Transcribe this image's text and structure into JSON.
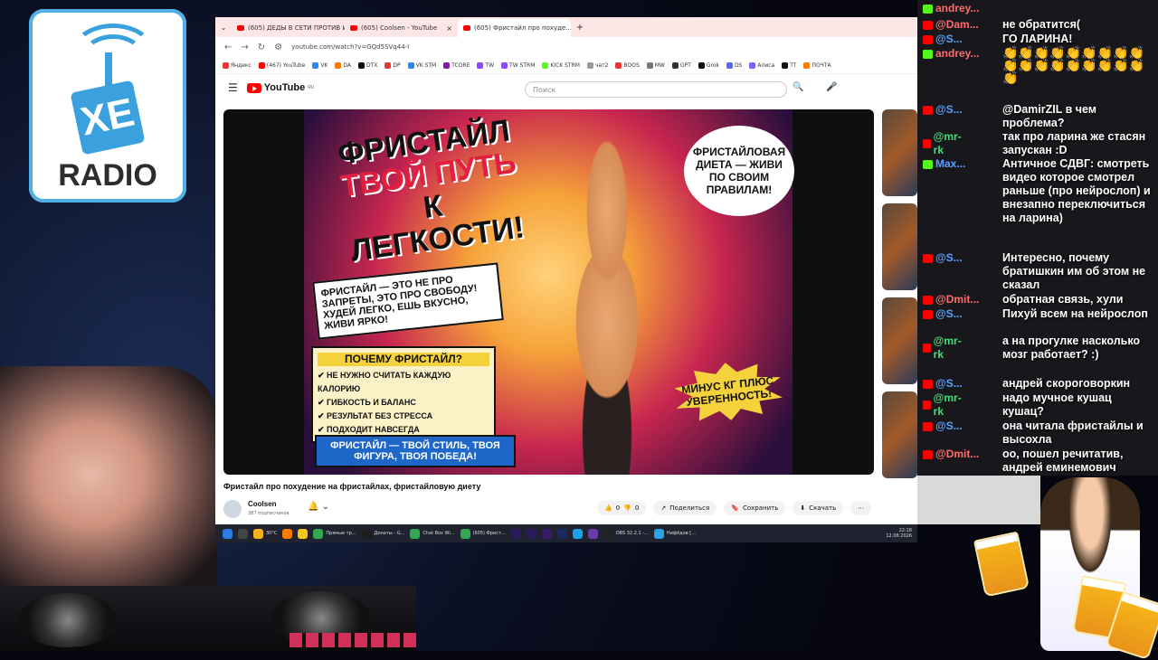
{
  "logo": {
    "text": "XE",
    "radio": "RADIO"
  },
  "browser": {
    "tabs": [
      {
        "title": "(605) ДЕДЫ В СЕТИ ПРОТИВ И...",
        "active": false
      },
      {
        "title": "(605) Coolsen - YouTube",
        "active": false
      },
      {
        "title": "(605) Фристайл про похуде...",
        "active": true
      }
    ],
    "new_tab": "+",
    "url": "youtube.com/watch?v=GQd5SVq44-I",
    "bookmarks": [
      {
        "label": "Яндекс",
        "color": "#e53935"
      },
      {
        "label": "(467) YouTube",
        "color": "#ff0000"
      },
      {
        "label": "VK",
        "color": "#2787f5"
      },
      {
        "label": "DA",
        "color": "#f57c00"
      },
      {
        "label": "DTX",
        "color": "#111"
      },
      {
        "label": "DP",
        "color": "#e53935"
      },
      {
        "label": "VK STM",
        "color": "#2787f5"
      },
      {
        "label": "TCORE",
        "color": "#7b1fa2"
      },
      {
        "label": "TW",
        "color": "#9146ff"
      },
      {
        "label": "TW STRM",
        "color": "#9146ff"
      },
      {
        "label": "KICK STRM",
        "color": "#53fc18"
      },
      {
        "label": "чат2",
        "color": "#999"
      },
      {
        "label": "BOOS",
        "color": "#e53935"
      },
      {
        "label": "MW",
        "color": "#777"
      },
      {
        "label": "GPT",
        "color": "#333"
      },
      {
        "label": "Grok",
        "color": "#111"
      },
      {
        "label": "DS",
        "color": "#5865f2"
      },
      {
        "label": "Алиса",
        "color": "#7b61ff"
      },
      {
        "label": "TT",
        "color": "#111"
      },
      {
        "label": "ПОЧТА",
        "color": "#f57c00"
      }
    ]
  },
  "youtube": {
    "logo": "YouTube",
    "region": "RU",
    "search_placeholder": "Поиск",
    "thumbnail": {
      "headline_1": "ФРИСТАЙЛ",
      "headline_2": "ТВОЙ ПУТЬ",
      "headline_3": "К ЛЕГКОСТИ!",
      "bubble_text": "ФРИСТАЙЛ — ЭТО НЕ ПРО ЗАПРЕТЫ, ЭТО ПРО СВОБОДУ! ХУДЕЙ ЛЕГКО, ЕШЬ ВКУСНО, ЖИВИ ЯРКО!",
      "why_title": "ПОЧЕМУ ФРИСТАЙЛ?",
      "why_items": [
        "НЕ НУЖНО СЧИТАТЬ КАЖДУЮ КАЛОРИЮ",
        "ГИБКОСТЬ И БАЛАНС",
        "РЕЗУЛЬТАТ БЕЗ СТРЕССА",
        "ПОДХОДИТ НАВСЕГДА"
      ],
      "footer_text": "ФРИСТАЙЛ — ТВОЙ СТИЛЬ, ТВОЯ ФИГУРА, ТВОЯ ПОБЕДА!",
      "diet_text": "ФРИСТАЙЛОВАЯ ДИЕТА — ЖИВИ ПО СВОИМ ПРАВИЛАМ!",
      "minus_text": "МИНУС КГ ПЛЮС УВЕРЕННОСТЬ!"
    },
    "video_title": "Фристайл про похудение на фристайлах, фристайловую диету",
    "channel": "Coolsen",
    "subscribers": "387 подписчиков",
    "likes": "0",
    "dislikes": "0",
    "share": "Поделиться",
    "save": "Сохранить",
    "download": "Скачать"
  },
  "taskbar": {
    "items": [
      {
        "label": "",
        "color": "#2a7de1"
      },
      {
        "label": "",
        "color": "#444"
      },
      {
        "label": "30°C",
        "color": "#f5b21a"
      },
      {
        "label": "",
        "color": "#ff7a00"
      },
      {
        "label": "",
        "color": "#f5c518"
      },
      {
        "label": "Прямые тр...",
        "color": "#34a853"
      },
      {
        "label": "Донаты - G...",
        "color": "#1d1d1d"
      },
      {
        "label": "Chat Box Wi...",
        "color": "#34a853"
      },
      {
        "label": "(605) Фрист...",
        "color": "#34a853"
      },
      {
        "label": "",
        "color": "#2a1a5e"
      },
      {
        "label": "",
        "color": "#2a1a5e"
      },
      {
        "label": "",
        "color": "#3a1a6e"
      },
      {
        "label": "",
        "color": "#1a2a5e"
      },
      {
        "label": "",
        "color": "#1aa3e8"
      },
      {
        "label": "",
        "color": "#6a3aa8"
      },
      {
        "label": "OBS 32.2.1 -...",
        "color": "#222"
      },
      {
        "label": "Нифёдов [...",
        "color": "#2aa3e8"
      }
    ],
    "time": "22:18",
    "date": "12.08.2026"
  },
  "chat": {
    "messages": [
      {
        "user": "andrey...",
        "user_color": "#ff6b6b",
        "platform": "kick",
        "text": ""
      },
      {
        "user": "@Dam...",
        "user_color": "#ff6b6b",
        "platform": "youtube",
        "text": "не обратится("
      },
      {
        "user": "@S...",
        "user_color": "#5aa0ff",
        "platform": "youtube",
        "text": "ГО ЛАРИНА!"
      },
      {
        "user": "andrey...",
        "user_color": "#ff6b6b",
        "platform": "kick",
        "text": ""
      },
      {
        "user": "@S...",
        "user_color": "#5aa0ff",
        "platform": "youtube",
        "text": "@DamirZIL в чем проблема?"
      },
      {
        "user": "@mr-rk",
        "user_color": "#44dd77",
        "platform": "youtube",
        "text": "так про ларина же стасян запускан :D"
      },
      {
        "user": "Max...",
        "user_color": "#5aa0ff",
        "platform": "kick",
        "text": "Античное СДВГ: смотреть видео которое смотрел раньше (про нейрослоп) и внезапно переключиться на ларина)"
      },
      {
        "user": "@S...",
        "user_color": "#5aa0ff",
        "platform": "youtube",
        "text": "Интересно, почему братишкин им об этом не сказал"
      },
      {
        "user": "@Dmit...",
        "user_color": "#ff6b6b",
        "platform": "youtube",
        "text": "обратная связь, хули"
      },
      {
        "user": "@S...",
        "user_color": "#5aa0ff",
        "platform": "youtube",
        "text": "Пихуй всем на нейрослоп"
      },
      {
        "user": "@mr-rk",
        "user_color": "#44dd77",
        "platform": "youtube",
        "text": "а на прогулке насколько мозг работает? :)"
      },
      {
        "user": "@S...",
        "user_color": "#5aa0ff",
        "platform": "youtube",
        "text": "андрей скороговоркин"
      },
      {
        "user": "@mr-rk",
        "user_color": "#44dd77",
        "platform": "youtube",
        "text": "надо мучное кушац кушац?"
      },
      {
        "user": "@S...",
        "user_color": "#5aa0ff",
        "platform": "youtube",
        "text": "она читала фристайлы и высохла"
      },
      {
        "user": "@Dmit...",
        "user_color": "#ff6b6b",
        "platform": "youtube",
        "text": "оо, пошел речитатив, андрей еминемович"
      }
    ],
    "emoji": "👏"
  },
  "colors": {
    "youtube_red": "#ff0000",
    "kick_green": "#53fc18",
    "tab_bg": "#fde6e6",
    "taskbar": "#1f2330"
  }
}
